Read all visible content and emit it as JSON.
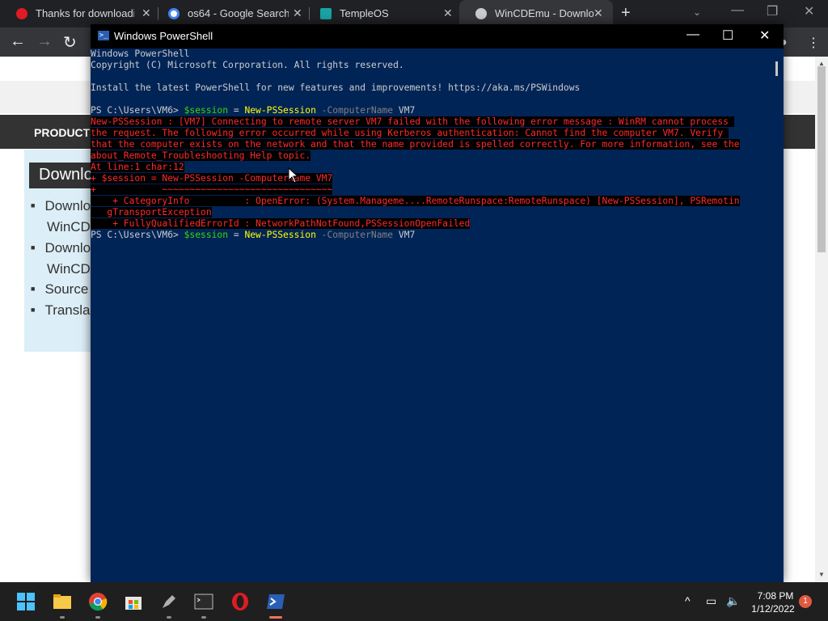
{
  "browser": {
    "tabs": [
      {
        "title": "Thanks for downloadin",
        "favicon_color": "#e01b24"
      },
      {
        "title": "os64 - Google Search",
        "favicon_color": "#4285f4"
      },
      {
        "title": "TempleOS",
        "favicon_color": "#1aa3a3"
      },
      {
        "title": "WinCDEmu - Downloa",
        "favicon_color": "#cccccc"
      }
    ],
    "new_tab": "+",
    "close_glyph": "✕",
    "minimize": "—",
    "restore": "❐",
    "close": "✕",
    "back": "←",
    "forward": "→",
    "reload": "↻"
  },
  "page": {
    "nav_label": "PRODUCTS",
    "download_header": "Downlo",
    "list": [
      {
        "text": "Downlo",
        "cont": "WinCDE"
      },
      {
        "text": "Downlo",
        "cont": "WinCDE"
      },
      {
        "text": "Source"
      },
      {
        "text": "Transla"
      }
    ]
  },
  "powershell": {
    "title": "Windows PowerShell",
    "minimize": "—",
    "maximize": "☐",
    "close": "✕",
    "lines": {
      "l1": "Windows PowerShell",
      "l2": "Copyright (C) Microsoft Corporation. All rights reserved.",
      "l3": "Install the latest PowerShell for new features and improvements! https://aka.ms/PSWindows",
      "prompt": "PS C:\\Users\\VM6> ",
      "var": "$session",
      "eq": " = ",
      "cmd": "New-PSSession",
      "param": " -ComputerName",
      "arg": " VM7",
      "e1": "New-PSSession : [VM7] Connecting to remote server VM7 failed with the following error message : WinRM cannot process ",
      "e2": "the request. The following error occurred while using Kerberos authentication: Cannot find the computer VM7. Verify ",
      "e3": "that the computer exists on the network and that the name provided is spelled correctly. For more information, see the",
      "e4": "about_Remote_Troubleshooting Help topic.",
      "e5": "At line:1 char:12",
      "e6": "+ $session = New-PSSession -ComputerName VM7",
      "e7": "+            ~~~~~~~~~~~~~~~~~~~~~~~~~~~~~~~",
      "e8": "    + CategoryInfo          : OpenError: (System.Manageme....RemoteRunspace:RemoteRunspace) [New-PSSession], PSRemotin",
      "e9": "   gTransportException",
      "e10": "    + FullyQualifiedErrorId : NetworkPathNotFound,PSSessionOpenFailed"
    }
  },
  "taskbar": {
    "time": "7:08 PM",
    "date": "1/12/2022",
    "notification_count": "1",
    "chevron": "^"
  }
}
